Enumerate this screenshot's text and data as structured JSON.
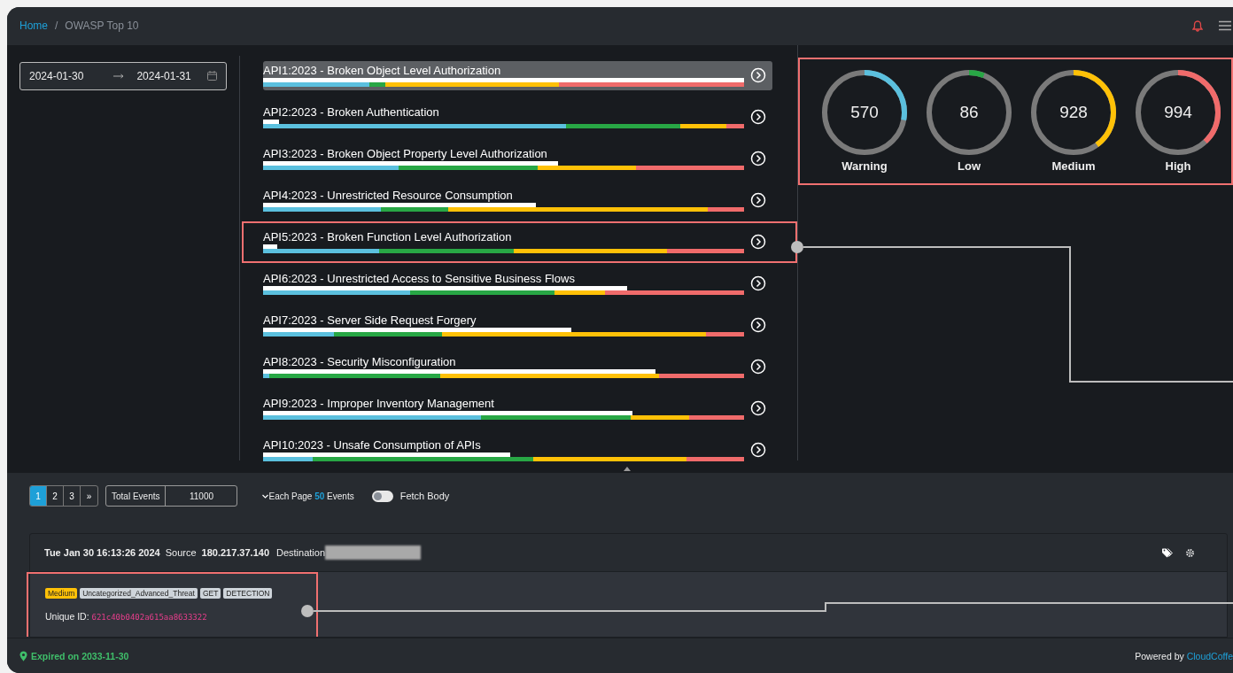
{
  "breadcrumb": {
    "items": [
      {
        "label": "Home",
        "kind": "link"
      },
      {
        "label": "OWASP Top 10",
        "kind": "current"
      }
    ],
    "separator": "/"
  },
  "date_range": {
    "start": "2024-01-30",
    "end": "2024-01-31"
  },
  "risks": [
    {
      "title": "API1:2023 - Broken Object Level Authorization",
      "selected": true,
      "highlighted": false
    },
    {
      "title": "API2:2023 - Broken Authentication",
      "selected": false,
      "highlighted": false
    },
    {
      "title": "API3:2023 - Broken Object Property Level Authorization",
      "selected": false,
      "highlighted": false
    },
    {
      "title": "API4:2023 - Unrestricted Resource Consumption",
      "selected": false,
      "highlighted": false
    },
    {
      "title": "API5:2023 - Broken Function Level Authorization",
      "selected": false,
      "highlighted": true
    },
    {
      "title": "API6:2023 - Unrestricted Access to Sensitive Business Flows",
      "selected": false,
      "highlighted": false
    },
    {
      "title": "API7:2023 - Server Side Request Forgery",
      "selected": false,
      "highlighted": false
    },
    {
      "title": "API8:2023 - Security Misconfiguration",
      "selected": false,
      "highlighted": false
    },
    {
      "title": "API9:2023 - Improper Inventory Management",
      "selected": false,
      "highlighted": false
    },
    {
      "title": "API10:2023 - Unsafe Consumption of APIs",
      "selected": false,
      "highlighted": false
    }
  ],
  "severity_panel": {
    "highlighted": true,
    "gauges": [
      {
        "value": "570",
        "label": "Warning",
        "color": "#5bc0de"
      },
      {
        "value": "86",
        "label": "Low",
        "color": "#28a745"
      },
      {
        "value": "928",
        "label": "Medium",
        "color": "#ffc107"
      },
      {
        "value": "994",
        "label": "High",
        "color": "#f06b6b"
      }
    ]
  },
  "pagination": {
    "pages": [
      {
        "label": "1",
        "selected": true
      },
      {
        "label": "2",
        "selected": false
      },
      {
        "label": "3",
        "selected": false
      },
      {
        "label": "»",
        "selected": false
      }
    ]
  },
  "total_events": {
    "label": "Total Events",
    "value": "11000"
  },
  "page_size": {
    "prefix": "Each Page",
    "value": "50",
    "suffix": "Events"
  },
  "fetch_body": {
    "label": "Fetch Body",
    "on": false
  },
  "event": {
    "time": "Tue Jan 30 16:13:26 2024",
    "source_label": "Source",
    "source": "180.217.37.140",
    "destination_label": "Destination",
    "highlighted": true,
    "tags": [
      {
        "label": "Medium",
        "color": "#ffc107"
      },
      {
        "label": "Uncategorized_Advanced_Threat",
        "color": "#ced4da"
      },
      {
        "label": "GET",
        "color": "#ced4da"
      },
      {
        "label": "DETECTION",
        "color": "#ced4da"
      }
    ],
    "unique_id_label": "Unique ID:",
    "unique_id": "621c40b0402a615aa8633322"
  },
  "footer": {
    "expiry": "Expired on 2033-11-30",
    "powered_by": "Powered by",
    "brand": "CloudCoffe"
  }
}
